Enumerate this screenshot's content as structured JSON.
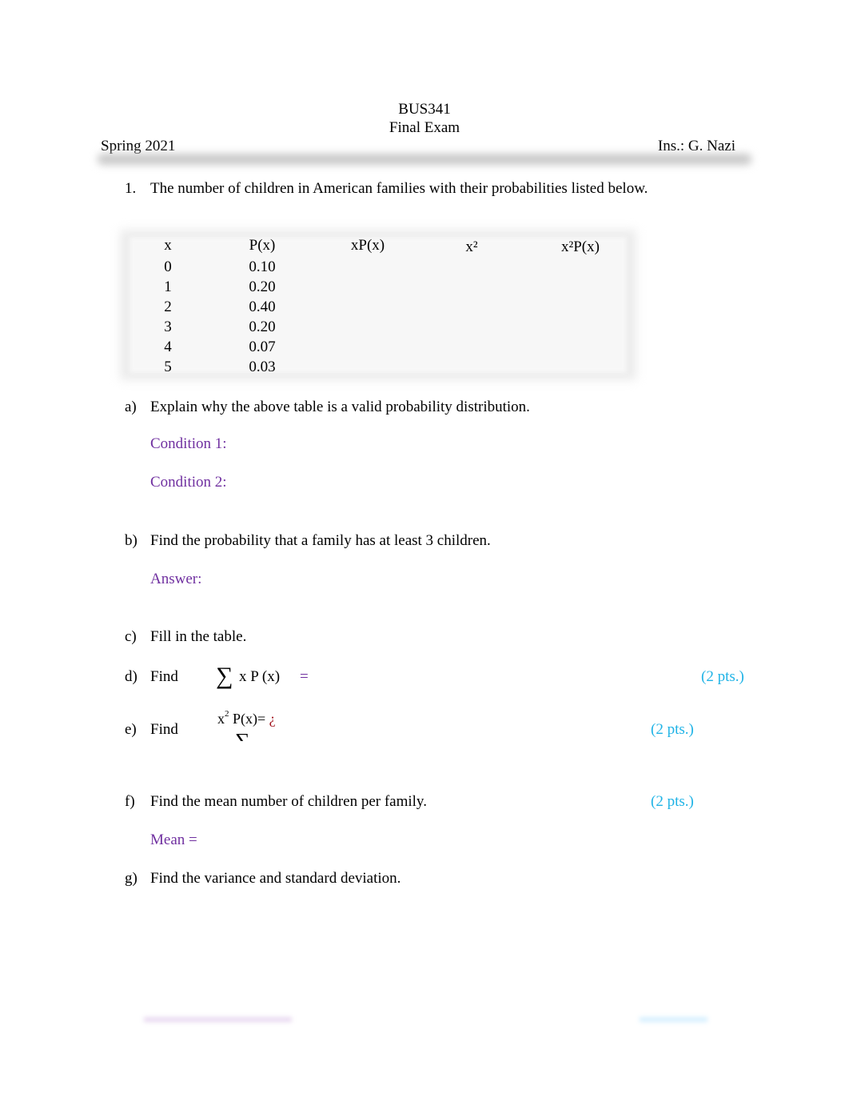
{
  "header": {
    "course": "BUS341",
    "exam": "Final Exam",
    "term": "Spring 2021",
    "instructor": "Ins.: G. Nazi"
  },
  "question1": {
    "number": "1.",
    "prompt": "The number of children in American families with their probabilities listed below.",
    "table": {
      "headers": [
        "x",
        "P(x)",
        "xP(x)",
        "x²",
        "x²P(x)"
      ],
      "rows": [
        {
          "x": "0",
          "p": "0.10"
        },
        {
          "x": "1",
          "p": "0.20"
        },
        {
          "x": "2",
          "p": "0.40"
        },
        {
          "x": "3",
          "p": "0.20"
        },
        {
          "x": "4",
          "p": "0.07"
        },
        {
          "x": "5",
          "p": "0.03"
        }
      ]
    },
    "parts": {
      "a": {
        "label": "a)",
        "text": "Explain why the above table is a valid probability distribution.",
        "condition1": "Condition 1:",
        "condition2": "Condition 2:"
      },
      "b": {
        "label": "b)",
        "text": "Find the probability that a family has at least 3 children.",
        "answer": "Answer:"
      },
      "c": {
        "label": "c)",
        "text": "Fill in the table."
      },
      "d": {
        "label": "d)",
        "text": "Find",
        "formula_sigma": "∑",
        "formula": "x P (x)",
        "equals": "=",
        "points": "(2 pts.)"
      },
      "e": {
        "label": "e)",
        "text": "Find",
        "formula_x": "x",
        "formula_sup": "2",
        "formula_rest": "P(x)=",
        "glyph": "¿",
        "sigma": "∑",
        "points": "(2 pts.)"
      },
      "f": {
        "label": "f)",
        "text": "Find the mean number of children per family.",
        "points": "(2 pts.)",
        "mean": "Mean ="
      },
      "g": {
        "label": "g)",
        "text": "Find the variance and standard deviation."
      }
    }
  },
  "colors": {
    "answer_label": "#7030a0",
    "points": "#1fb3e6",
    "glyph": "#a0101a"
  }
}
